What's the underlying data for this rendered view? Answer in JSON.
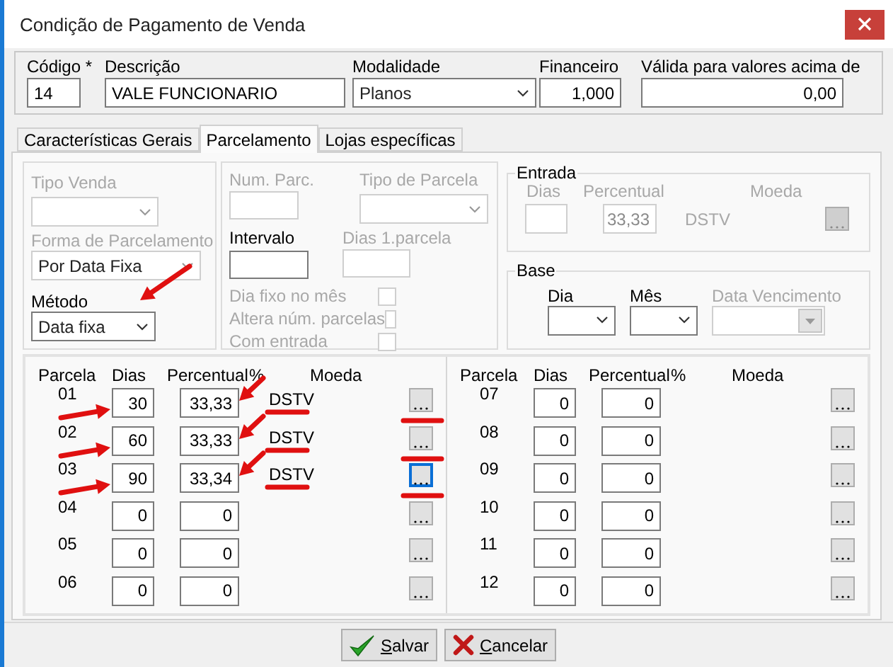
{
  "window": {
    "title": "Condição de Pagamento de Venda"
  },
  "header": {
    "fields": [
      {
        "label": "Código *",
        "value": "14",
        "kind": "text"
      },
      {
        "label": "Descrição",
        "value": "VALE FUNCIONARIO",
        "kind": "text"
      },
      {
        "label": "Modalidade",
        "value": "Planos",
        "kind": "select"
      },
      {
        "label": "Financeiro",
        "value": "1,000",
        "kind": "number"
      },
      {
        "label": "Válida para valores acima de",
        "value": "0,00",
        "kind": "number"
      }
    ]
  },
  "tabs": [
    {
      "label": "Características Gerais",
      "selected": false
    },
    {
      "label": "Parcelamento",
      "selected": true
    },
    {
      "label": "Lojas específicas",
      "selected": false
    }
  ],
  "sale_group": {
    "tipo_venda": {
      "label": "Tipo Venda",
      "disabled": true
    },
    "forma_parcelamento": {
      "label": "Forma de Parcelamento",
      "value": "Por Data Fixa",
      "disabled": true
    },
    "metodo": {
      "label": "Método",
      "value": "Data fixa",
      "disabled": false,
      "annotated": true
    }
  },
  "installment_group": {
    "num_parc": {
      "label": "Num. Parc.",
      "disabled": true
    },
    "tipo_parcela": {
      "label": "Tipo de Parcela",
      "disabled": true
    },
    "intervalo": {
      "label": "Intervalo",
      "disabled": false
    },
    "dias_1_parcela": {
      "label": "Dias 1.parcela",
      "disabled": true
    },
    "checkboxes": [
      {
        "label": "Dia fixo no mês",
        "checked": false
      },
      {
        "label": "Altera núm. parcelas",
        "checked": false
      },
      {
        "label": "Com entrada",
        "checked": false
      }
    ]
  },
  "entrada": {
    "title": "Entrada",
    "dias_label": "Dias",
    "percentual_label": "Percentual",
    "moeda_label": "Moeda",
    "percentual": "33,33",
    "moeda": "DSTV",
    "disabled": true
  },
  "base": {
    "title": "Base",
    "dia": {
      "label": "Dia",
      "disabled": false
    },
    "mes": {
      "label": "Mês",
      "disabled": false
    },
    "data_vencimento": {
      "label": "Data Vencimento",
      "disabled": true
    }
  },
  "installment_panels": [
    {
      "columns": [
        "Parcela",
        "Dias",
        "Percentual",
        "%",
        "Moeda"
      ],
      "rows": [
        {
          "parcela": "01",
          "dias": "30",
          "percentual": "33,33",
          "moeda": "DSTV",
          "annotated": true,
          "focused": false
        },
        {
          "parcela": "02",
          "dias": "60",
          "percentual": "33,33",
          "moeda": "DSTV",
          "annotated": true,
          "focused": false
        },
        {
          "parcela": "03",
          "dias": "90",
          "percentual": "33,34",
          "moeda": "DSTV",
          "annotated": true,
          "focused": true
        },
        {
          "parcela": "04",
          "dias": "0",
          "percentual": "0",
          "annotated": false,
          "focused": false
        },
        {
          "parcela": "05",
          "dias": "0",
          "percentual": "0",
          "annotated": false,
          "focused": false
        },
        {
          "parcela": "06",
          "dias": "0",
          "percentual": "0",
          "annotated": false,
          "focused": false
        }
      ]
    },
    {
      "columns": [
        "Parcela",
        "Dias",
        "Percentual",
        "%",
        "Moeda"
      ],
      "rows": [
        {
          "parcela": "07",
          "dias": "0",
          "percentual": "0",
          "annotated": false,
          "focused": false
        },
        {
          "parcela": "08",
          "dias": "0",
          "percentual": "0",
          "annotated": false,
          "focused": false
        },
        {
          "parcela": "09",
          "dias": "0",
          "percentual": "0",
          "annotated": false,
          "focused": false
        },
        {
          "parcela": "10",
          "dias": "0",
          "percentual": "0",
          "annotated": false,
          "focused": false
        },
        {
          "parcela": "11",
          "dias": "0",
          "percentual": "0",
          "annotated": false,
          "focused": false
        },
        {
          "parcela": "12",
          "dias": "0",
          "percentual": "0",
          "annotated": false,
          "focused": false
        }
      ]
    }
  ],
  "buttons": [
    {
      "label": "Salvar",
      "kind": "save"
    },
    {
      "label": "Cancelar",
      "kind": "cancel"
    }
  ]
}
